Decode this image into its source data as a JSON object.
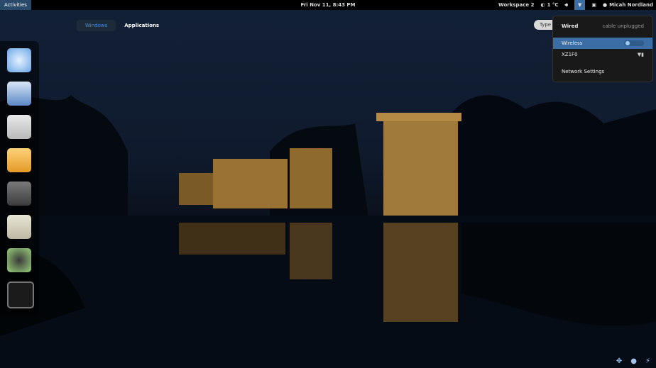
{
  "topbar": {
    "activities": "Activities",
    "datetime": "Fri Nov 11,  8:43 PM",
    "workspace": "Workspace 2",
    "temperature": "1 °C",
    "user": "Micah Nordland",
    "icons": [
      "moon-icon",
      "volume-icon",
      "network-icon",
      "clipboard-icon",
      "chat-icon"
    ]
  },
  "overview": {
    "tabs": [
      {
        "label": "Windows"
      },
      {
        "label": "Applications"
      }
    ],
    "search_placeholder": "Type"
  },
  "dash": {
    "apps": [
      "chromium-icon",
      "writer-icon",
      "files-icon",
      "banshee-icon",
      "settings-icon",
      "calculator-icon",
      "cheese-icon",
      "terminal-icon"
    ]
  },
  "network_menu": {
    "wired_label": "Wired",
    "wired_status": "cable unplugged",
    "wireless_label": "Wireless",
    "network_name": "XZ1F0",
    "settings_label": "Network Settings"
  },
  "bottom_icons": [
    "move-icon",
    "globe-icon",
    "power-icon"
  ]
}
